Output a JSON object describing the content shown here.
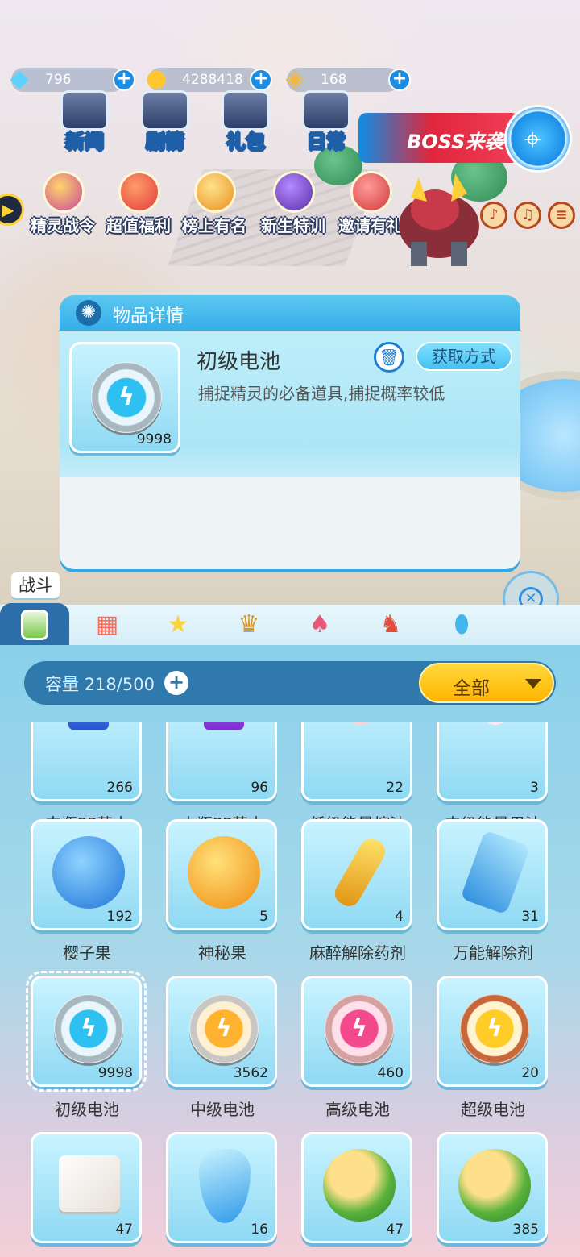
{
  "resources": [
    {
      "icon": "diamond-icon",
      "value": "796"
    },
    {
      "icon": "cat-coin-icon",
      "value": "4288418"
    },
    {
      "icon": "gold-ticket-icon",
      "value": "168"
    }
  ],
  "nav": [
    {
      "label": "新闻"
    },
    {
      "label": "剧情"
    },
    {
      "label": "礼包"
    },
    {
      "label": "日常"
    }
  ],
  "banner": {
    "label": "BOSS来袭"
  },
  "activities": [
    {
      "label": "精灵战令"
    },
    {
      "label": "超值福利"
    },
    {
      "label": "榜上有名"
    },
    {
      "label": "新生特训"
    },
    {
      "label": "邀请有礼"
    }
  ],
  "detail": {
    "title": "物品详情",
    "item_name": "初级电池",
    "item_count": "9998",
    "description": "捕捉精灵的必备道具,捕捉概率较低",
    "acquire_label": "获取方式"
  },
  "bag": {
    "active_tab_label": "战斗",
    "capacity_label": "容量",
    "capacity_value": "218/500",
    "filter_label": "全部",
    "items": [
      {
        "name": "中瓶PP药水",
        "count": "266"
      },
      {
        "name": "大瓶PP药水",
        "count": "96"
      },
      {
        "name": "低级能量榨汁",
        "count": "22"
      },
      {
        "name": "中级能量果汁",
        "count": "3"
      },
      {
        "name": "樱子果",
        "count": "192"
      },
      {
        "name": "神秘果",
        "count": "5"
      },
      {
        "name": "麻醉解除药剂",
        "count": "4"
      },
      {
        "name": "万能解除剂",
        "count": "31"
      },
      {
        "name": "初级电池",
        "count": "9998"
      },
      {
        "name": "中级电池",
        "count": "3562"
      },
      {
        "name": "高级电池",
        "count": "460"
      },
      {
        "name": "超级电池",
        "count": "20"
      },
      {
        "name": "",
        "count": "47"
      },
      {
        "name": "",
        "count": "16"
      },
      {
        "name": "",
        "count": "47"
      },
      {
        "name": "",
        "count": "385"
      }
    ]
  }
}
